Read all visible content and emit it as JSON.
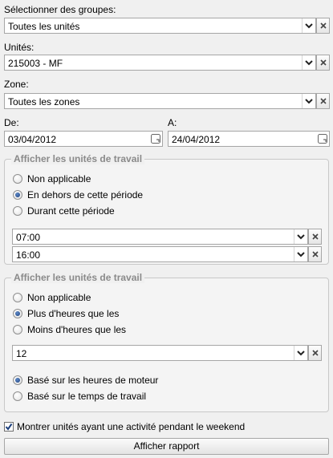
{
  "groups": {
    "label": "Sélectionner des groupes:",
    "value": "Toutes les unités"
  },
  "units": {
    "label": "Unités:",
    "value": "215003 - MF"
  },
  "zone": {
    "label": "Zone:",
    "value": "Toutes les zones"
  },
  "date_range": {
    "from_label": "De:",
    "from_value": "03/04/2012",
    "to_label": "A:",
    "to_value": "24/04/2012"
  },
  "work_units_period": {
    "title": "Afficher les unités de travail",
    "options": [
      "Non applicable",
      "En dehors de cette période",
      "Durant cette période"
    ],
    "selected_index": 1,
    "start_time": "07:00",
    "end_time": "16:00"
  },
  "work_units_hours": {
    "title": "Afficher les unités de travail",
    "options": [
      "Non applicable",
      "Plus d'heures que les",
      "Moins d'heures que les"
    ],
    "selected_index": 1,
    "hours_value": "12",
    "basis_options": [
      "Basé sur les heures de moteur",
      "Basé sur le temps de travail"
    ],
    "basis_selected_index": 0
  },
  "weekend": {
    "label": "Montrer unités ayant une activité pendant le weekend",
    "checked": true
  },
  "show_report_button": "Afficher rapport",
  "icons": {
    "dropdown": "chevron-down-icon",
    "clear": "close-icon",
    "calendar": "calendar-icon",
    "check": "checkmark-icon"
  }
}
